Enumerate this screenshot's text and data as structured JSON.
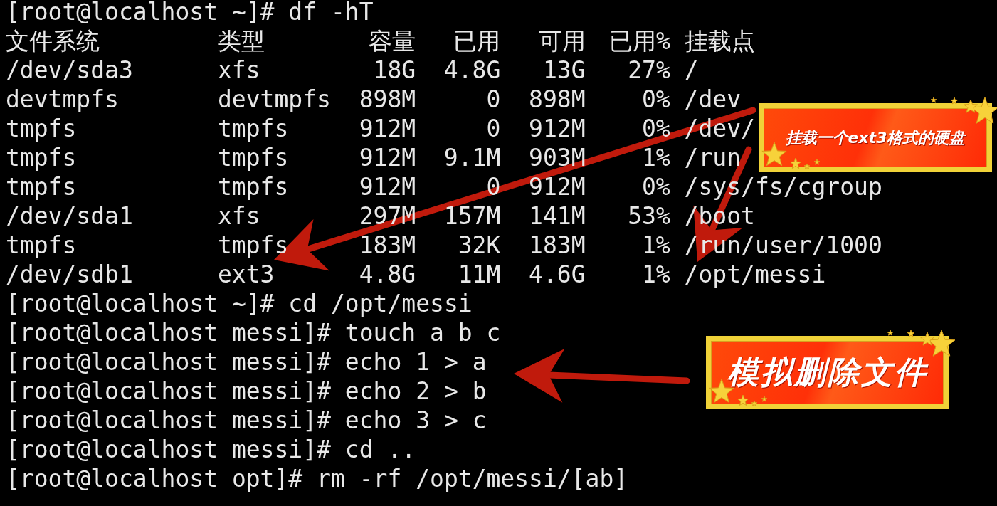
{
  "terminal": {
    "lines_before": [
      "[root@localhost ~]# df -hT"
    ],
    "df_table": {
      "columns": [
        "文件系统",
        "类型",
        "容量",
        "已用",
        "可用",
        "已用%",
        "挂载点"
      ],
      "rows": [
        [
          "/dev/sda3",
          "xfs",
          "18G",
          "4.8G",
          "13G",
          "27%",
          "/"
        ],
        [
          "devtmpfs",
          "devtmpfs",
          "898M",
          "0",
          "898M",
          "0%",
          "/dev"
        ],
        [
          "tmpfs",
          "tmpfs",
          "912M",
          "0",
          "912M",
          "0%",
          "/dev/"
        ],
        [
          "tmpfs",
          "tmpfs",
          "912M",
          "9.1M",
          "903M",
          "1%",
          "/run"
        ],
        [
          "tmpfs",
          "tmpfs",
          "912M",
          "0",
          "912M",
          "0%",
          "/sys/fs/cgroup"
        ],
        [
          "/dev/sda1",
          "xfs",
          "297M",
          "157M",
          "141M",
          "53%",
          "/boot"
        ],
        [
          "tmpfs",
          "tmpfs",
          "183M",
          "32K",
          "183M",
          "1%",
          "/run/user/1000"
        ],
        [
          "/dev/sdb1",
          "ext3",
          "4.8G",
          "11M",
          "4.6G",
          "1%",
          "/opt/messi"
        ]
      ]
    },
    "lines_after": [
      "[root@localhost ~]# cd /opt/messi",
      "[root@localhost messi]# touch a b c",
      "[root@localhost messi]# echo 1 > a",
      "[root@localhost messi]# echo 2 > b",
      "[root@localhost messi]# echo 3 > c",
      "[root@localhost messi]# cd ..",
      "[root@localhost opt]# rm -rf /opt/messi/[ab]"
    ]
  },
  "annotations": [
    {
      "text": "挂载一个ext3格式的硬盘"
    },
    {
      "text": "模拟删除文件"
    }
  ]
}
